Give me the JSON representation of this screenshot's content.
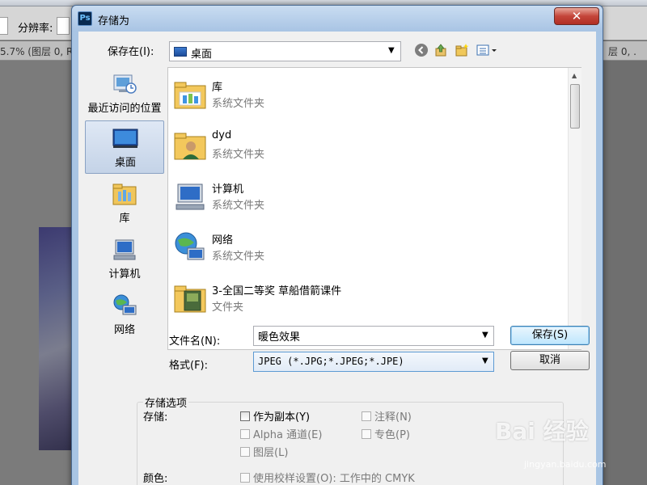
{
  "background": {
    "options_resolution_label": "分辨率:",
    "tab_left_text": "5.7% (图层 0, R",
    "tab_right_text": "层 0, ."
  },
  "dialog": {
    "title": "存储为",
    "app_icon_text": "Ps",
    "close_symbol": "✕"
  },
  "save_in": {
    "label": "保存在(I):",
    "value": "桌面",
    "toolbar_icons": [
      "back-icon",
      "up-folder-icon",
      "new-folder-icon",
      "view-menu-icon"
    ]
  },
  "places": [
    {
      "label": "最近访问的位置",
      "icon": "recent-places-icon",
      "selected": false
    },
    {
      "label": "桌面",
      "icon": "desktop-icon",
      "selected": true
    },
    {
      "label": "库",
      "icon": "libraries-icon",
      "selected": false
    },
    {
      "label": "计算机",
      "icon": "computer-icon",
      "selected": false
    },
    {
      "label": "网络",
      "icon": "network-icon",
      "selected": false
    }
  ],
  "files": [
    {
      "name": "库",
      "type": "系统文件夹",
      "icon": "libraries-folder-icon"
    },
    {
      "name": "dyd",
      "type": "系统文件夹",
      "icon": "user-folder-icon"
    },
    {
      "name": "计算机",
      "type": "系统文件夹",
      "icon": "computer-icon"
    },
    {
      "name": "网络",
      "type": "系统文件夹",
      "icon": "network-icon"
    },
    {
      "name": "3-全国二等奖 草船借箭课件",
      "type": "文件夹",
      "icon": "folder-icon"
    }
  ],
  "filename": {
    "label": "文件名(N):",
    "value": "暖色效果"
  },
  "format": {
    "label": "格式(F):",
    "value": "JPEG (*.JPG;*.JPEG;*.JPE)"
  },
  "buttons": {
    "save": "保存(S)",
    "cancel": "取消"
  },
  "options": {
    "group_title": "存储选项",
    "save_label": "存储:",
    "as_copy": "作为副本(Y)",
    "annotations": "注释(N)",
    "alpha": "Alpha 通道(E)",
    "spot": "专色(P)",
    "layers": "图层(L)",
    "color_label": "颜色:",
    "use_proof": "使用校样设置(O): 工作中的 CMYK"
  },
  "watermark": {
    "text": "Bai  经验",
    "sub": "jingyan.baidu.com"
  }
}
